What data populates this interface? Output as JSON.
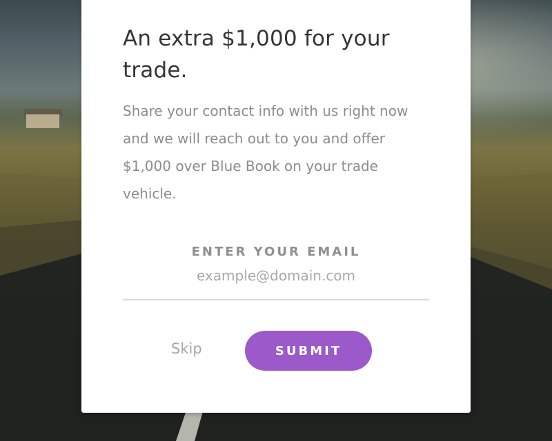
{
  "background": {
    "description_colors": {
      "sky": "#55636a",
      "field": "#6d6537",
      "road": "#1e1f1c"
    }
  },
  "modal": {
    "title": "An extra $1,000 for your trade.",
    "body": "Share your contact info with us right now and we will reach out to you and offer $1,000 over Blue Book on your trade vehicle.",
    "email_label": "ENTER YOUR EMAIL",
    "email_placeholder": "example@domain.com",
    "email_value": "",
    "skip_label": "Skip",
    "submit_label": "SUBMIT"
  },
  "colors": {
    "accent": "#9b59c9",
    "title_text": "#343434",
    "body_text": "#8c8c8c"
  }
}
